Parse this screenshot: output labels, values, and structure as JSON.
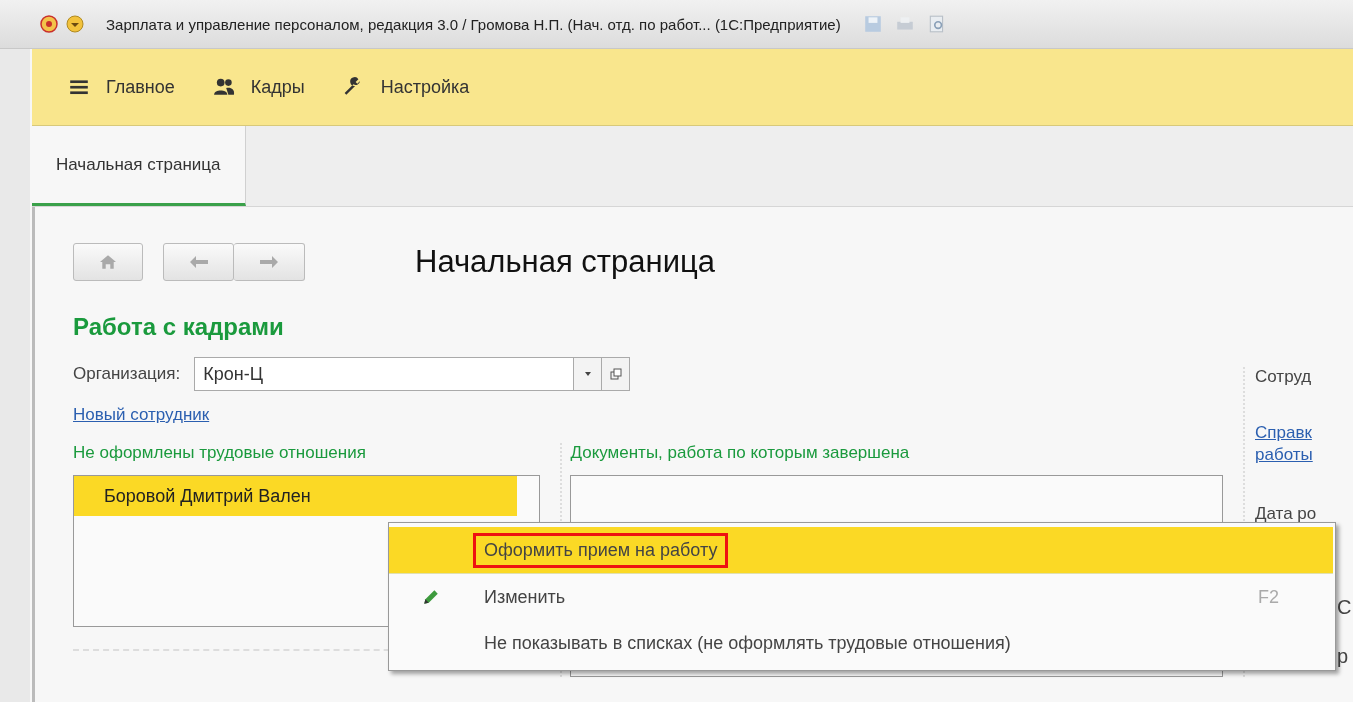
{
  "window": {
    "title": "Зарплата и управление персоналом, редакция 3.0 / Громова Н.П. (Нач. отд. по работ...  (1С:Предприятие)"
  },
  "sections": [
    {
      "label": "Главное",
      "kind": "menu"
    },
    {
      "label": "Кадры",
      "kind": "people"
    },
    {
      "label": "Настройка",
      "kind": "wrench"
    }
  ],
  "tabs": [
    {
      "label": "Начальная страница",
      "selected": true
    }
  ],
  "page": {
    "title": "Начальная страница",
    "heading": "Работа с кадрами",
    "organization_label": "Организация:",
    "organization_value": "Крон-Ц",
    "new_employee_link": "Новый сотрудник"
  },
  "not_registered": {
    "title": "Не оформлены трудовые отношения",
    "rows": [
      {
        "text": "Боровой Дмитрий Вален",
        "selected": true
      }
    ]
  },
  "documents": {
    "title": "Документы, работа по которым завершена"
  },
  "right_column": {
    "heading": "Сотруд",
    "link": [
      "Справк",
      "работы"
    ],
    "label": "Дата ро",
    "fragments": [
      "С",
      "р"
    ]
  },
  "context_menu": [
    {
      "label": "Оформить прием на работу",
      "selected": true,
      "outlined": true,
      "kind": "plain"
    },
    {
      "label": "Изменить",
      "selected": false,
      "outlined": false,
      "kind": "edit",
      "shortcut": "F2"
    },
    {
      "label": "Не показывать в списках (не оформлять трудовые отношения)",
      "selected": false,
      "outlined": false,
      "kind": "plain"
    }
  ]
}
